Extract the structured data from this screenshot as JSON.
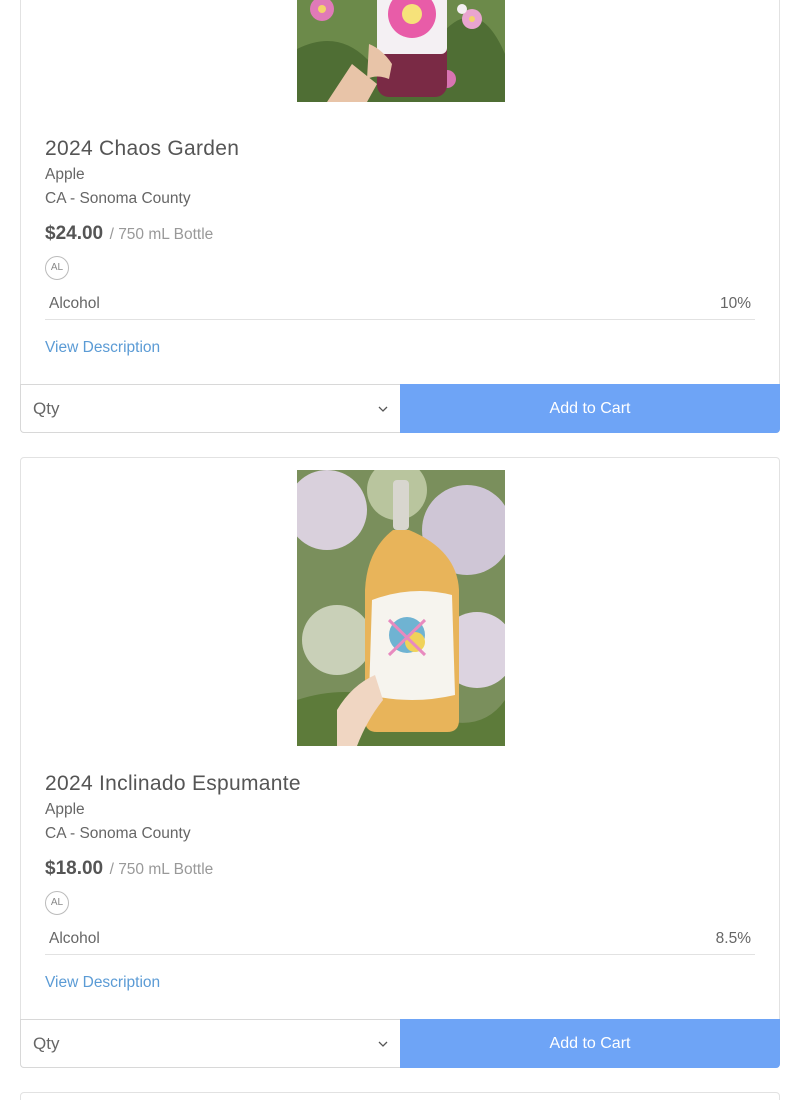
{
  "products": [
    {
      "name": "2024 Chaos Garden",
      "variety": "Apple",
      "region": "CA - Sonoma County",
      "price": "$24.00",
      "unit": "/ 750 mL Bottle",
      "badge": "AL",
      "spec_label": "Alcohol",
      "spec_value": "10%",
      "view_description": "View Description",
      "qty_label": "Qty",
      "add_to_cart": "Add to Cart"
    },
    {
      "name": "2024 Inclinado Espumante",
      "variety": "Apple",
      "region": "CA - Sonoma County",
      "price": "$18.00",
      "unit": "/ 750 mL Bottle",
      "badge": "AL",
      "spec_label": "Alcohol",
      "spec_value": "8.5%",
      "view_description": "View Description",
      "qty_label": "Qty",
      "add_to_cart": "Add to Cart"
    }
  ],
  "colors": {
    "accent": "#6ea4f6",
    "link": "#5b9bd5",
    "border": "#e2e2e2"
  }
}
